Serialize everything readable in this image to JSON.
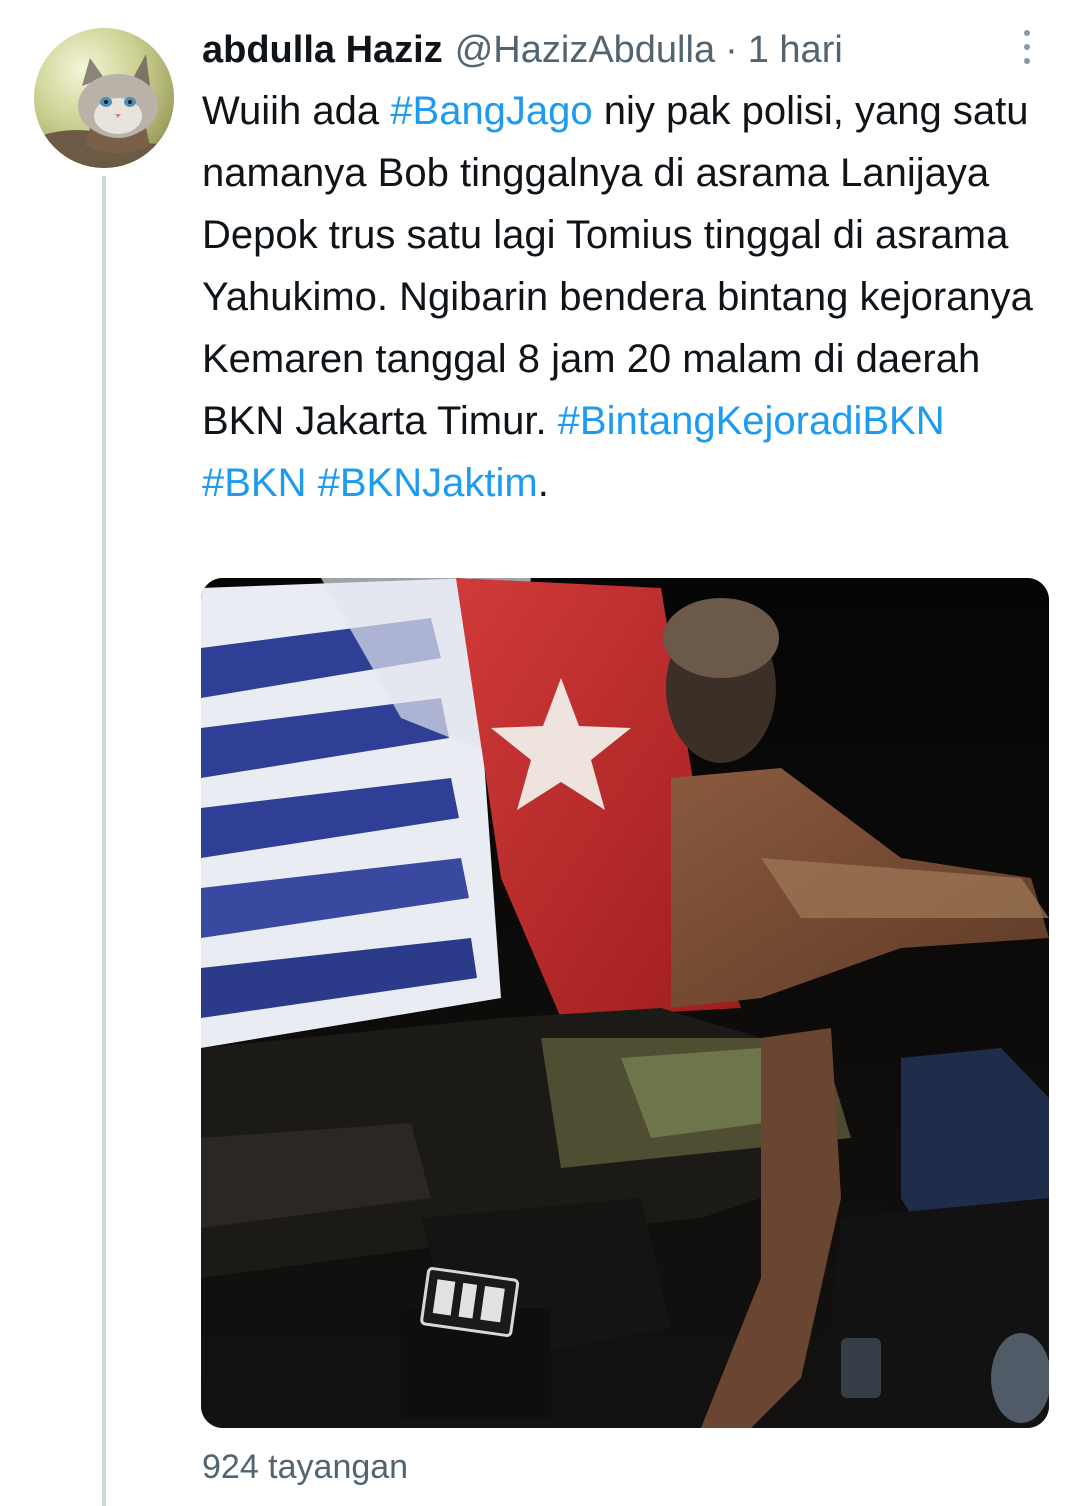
{
  "tweet": {
    "author_name": "abdulla Haziz",
    "handle": "@HazizAbdulla",
    "separator": "·",
    "time": "1 hari",
    "text_segments": [
      {
        "text": "Wuiih ada ",
        "type": "text"
      },
      {
        "text": "#BangJago",
        "type": "hashtag"
      },
      {
        "text": " niy pak polisi, yang satu namanya Bob tinggalnya di asrama Lanijaya Depok trus satu lagi Tomius tinggal di asrama Yahukimo. Ngibarin bendera bintang kejoranya Kemaren tanggal 8 jam 20 malam di daerah BKN Jakarta Timur. ",
        "type": "text"
      },
      {
        "text": "#BintangKejoradiBKN",
        "type": "hashtag"
      },
      {
        "text": " ",
        "type": "text"
      },
      {
        "text": "#BKN",
        "type": "hashtag"
      },
      {
        "text": "  ",
        "type": "text"
      },
      {
        "text": "#BKNJaktim",
        "type": "hashtag"
      },
      {
        "text": ".",
        "type": "text"
      }
    ],
    "views": "924 tayangan",
    "more_icon": "more-vertical-icon",
    "colors": {
      "name": "#0f1419",
      "secondary": "#536471",
      "hashtag": "#1d9bf0",
      "thread_line": "#cfd9de"
    }
  }
}
